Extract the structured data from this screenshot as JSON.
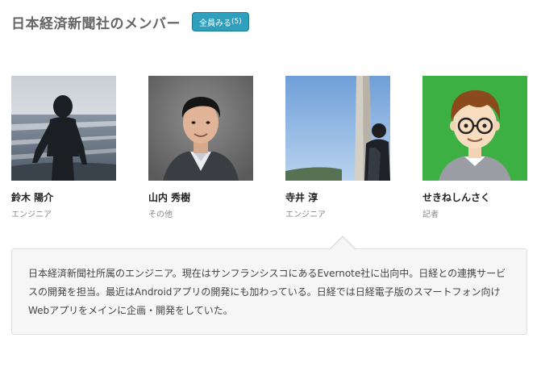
{
  "header": {
    "title": "日本経済新聞社のメンバー",
    "view_all_label": "全員みる",
    "view_all_count": "(5)"
  },
  "members": [
    {
      "name": "鈴木 陽介",
      "role": "エンジニア"
    },
    {
      "name": "山内 秀樹",
      "role": "その他"
    },
    {
      "name": "寺井 淳",
      "role": "エンジニア"
    },
    {
      "name": "せきねしんさく",
      "role": "記者"
    }
  ],
  "bio": {
    "text": "日本経済新聞社所属のエンジニア。現在はサンフランシスコにあるEvernote社に出向中。日経との連携サービスの開発を担当。最近はAndroidアプリの開発にも加わっている。日経では日経電子版のスマートフォン向けWebアプリをメインに企画・開発をしていた。"
  },
  "colors": {
    "accent_button": "#2e9fbd",
    "bio_background": "#f6f6f6",
    "avatar_background": "#3cb043"
  }
}
